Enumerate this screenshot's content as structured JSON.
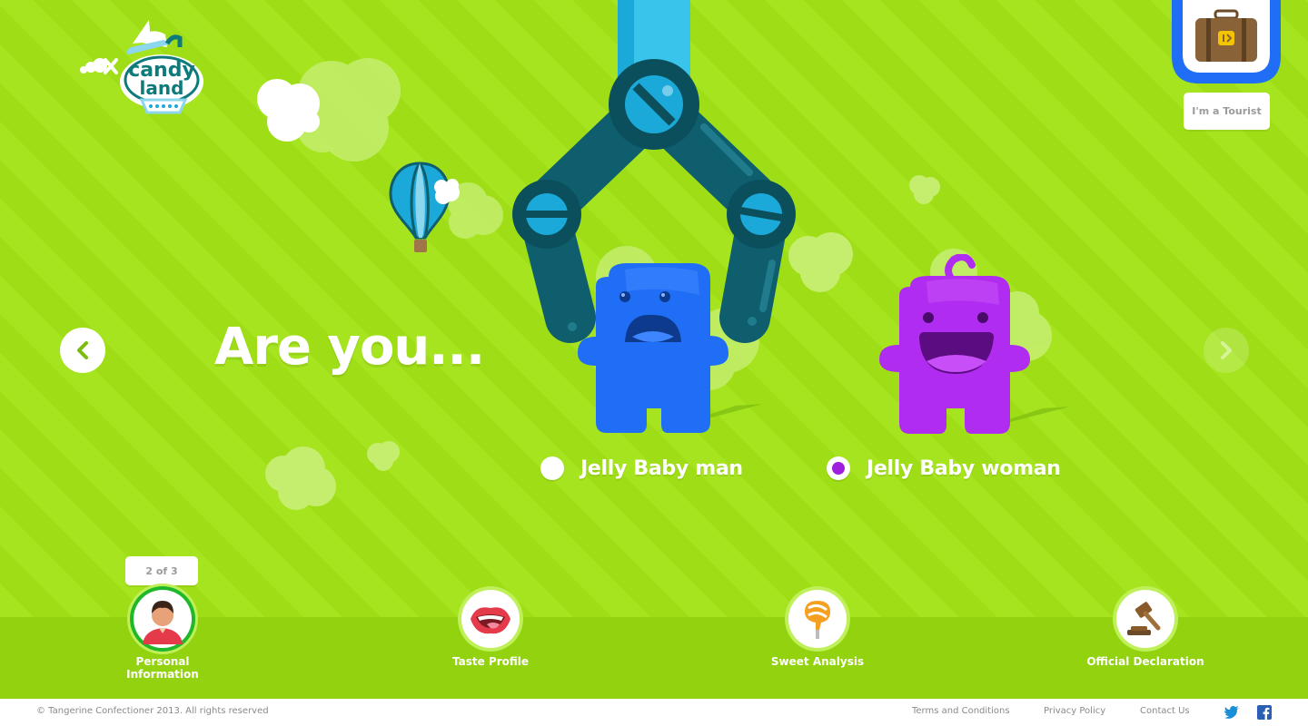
{
  "brand": {
    "logo_text_1": "candy",
    "logo_text_2": "land"
  },
  "tourist": {
    "label": "I'm a Tourist",
    "icon": "suitcase-icon"
  },
  "question": {
    "headline": "Are you..."
  },
  "options": [
    {
      "label": "Jelly Baby man",
      "selected": false,
      "color": "#1f6ef5"
    },
    {
      "label": "Jelly Baby woman",
      "selected": true,
      "color": "#b02cf0"
    }
  ],
  "navigation": {
    "prev_icon": "chevron-left-icon",
    "next_icon": "chevron-right-icon"
  },
  "progress": {
    "tooltip": "2 of 3",
    "current_step": 2,
    "total_steps": 3
  },
  "steps": [
    {
      "label": "Personal Information",
      "icon": "person-icon"
    },
    {
      "label": "Taste Profile",
      "icon": "mouth-icon"
    },
    {
      "label": "Sweet Analysis",
      "icon": "lollipop-icon"
    },
    {
      "label": "Official Declaration",
      "icon": "gavel-icon"
    }
  ],
  "footer": {
    "copyright": "© Tangerine Confectioner 2013. All rights reserved",
    "links": [
      "Terms and Conditions",
      "Privacy Policy",
      "Contact Us"
    ],
    "social": [
      "twitter-icon",
      "facebook-icon"
    ]
  },
  "colors": {
    "background": "#a5e41e",
    "accent_blue": "#1f6ef5",
    "accent_purple": "#b02cf0",
    "claw": "#0f5e6e"
  }
}
